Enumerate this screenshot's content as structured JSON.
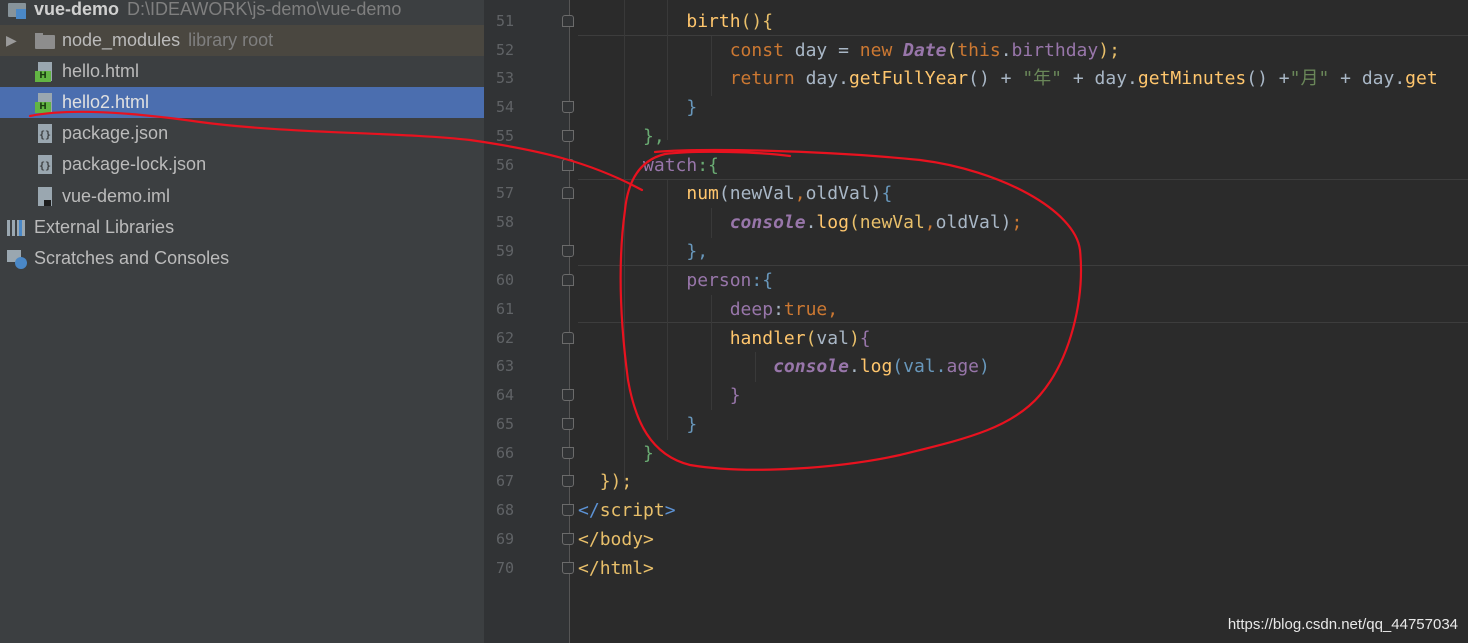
{
  "project_tree": {
    "root": {
      "name": "vue-demo",
      "path": "D:\\IDEAWORK\\js-demo\\vue-demo"
    },
    "items": [
      {
        "name": "node_modules",
        "hint": "library root"
      },
      {
        "name": "hello.html"
      },
      {
        "name": "hello2.html"
      },
      {
        "name": "package.json"
      },
      {
        "name": "package-lock.json"
      },
      {
        "name": "vue-demo.iml"
      },
      {
        "name": "External Libraries"
      },
      {
        "name": "Scratches and Consoles"
      }
    ]
  },
  "editor": {
    "line_numbers": [
      "51",
      "52",
      "53",
      "54",
      "55",
      "56",
      "57",
      "58",
      "59",
      "60",
      "61",
      "62",
      "63",
      "64",
      "65",
      "66",
      "67",
      "68",
      "69",
      "70"
    ],
    "lines": [
      [
        "birth",
        "(){"
      ],
      [
        "const",
        " day = ",
        "new",
        " ",
        "Date",
        "(",
        "this",
        ".",
        "birthday",
        ");"
      ],
      [
        "return",
        " day.",
        "getFullYear",
        "() + ",
        "\"年\"",
        " + day.",
        "getMinutes",
        "() +",
        "\"月\"",
        " + day.",
        "get"
      ],
      [
        "}"
      ],
      [
        "},"
      ],
      [
        "watch",
        ":{"
      ],
      [
        "num",
        "(newVal",
        ",",
        "oldVal)",
        "{"
      ],
      [
        "console",
        ".",
        "log",
        "(newVal",
        ",",
        "oldVal)",
        ";"
      ],
      [
        "},"
      ],
      [
        "person",
        ":{"
      ],
      [
        "deep",
        ":",
        "true",
        ","
      ],
      [
        "handler",
        "(",
        "val",
        ")",
        "{"
      ],
      [
        "console",
        ".",
        "log",
        "(val.",
        "age",
        ")"
      ],
      [
        "}"
      ],
      [
        "}"
      ],
      [
        "}"
      ],
      [
        "});"
      ],
      [
        "</",
        "script",
        ">"
      ],
      [
        "</",
        "body",
        ">"
      ],
      [
        "</",
        "html",
        ">"
      ]
    ]
  },
  "watermark": "https://blog.csdn.net/qq_44757034",
  "colors": {
    "annotation": "#e8121f",
    "selection": "#4b6eaf",
    "keyword": "#cc7832",
    "function": "#ffc66d",
    "property": "#9876aa",
    "string": "#6a8759"
  }
}
